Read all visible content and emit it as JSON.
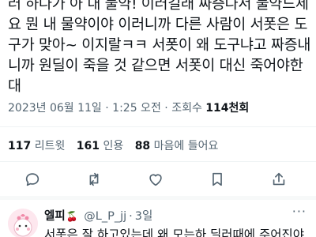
{
  "tweet": {
    "lines": [
      "러 하나가 아 내 물약! 이러길래 짜증나서 물약드세",
      "요 뭔 내 물약이야 이러니까 다른 사람이 서폿은 도",
      "구가 맞아~ 이지랄ㅋㅋ 서폿이 왜 도구냐고 짜증내",
      "니까 원딜이 죽을 것 같으면 서폿이 대신 죽어야한",
      "대"
    ],
    "date": "2023년 06월 11일",
    "time": "1:25 오전",
    "views_label": "조회수",
    "views_count": "114천회"
  },
  "stats": {
    "retweets_count": "117",
    "retweets_label": "리트윗",
    "quotes_count": "161",
    "quotes_label": "인용",
    "likes_count": "88",
    "likes_label": "마음에 들어요"
  },
  "actions": [
    "reply-icon",
    "retweet-icon",
    "like-icon",
    "bookmark-icon",
    "share-icon"
  ],
  "reply": {
    "name": "엘피",
    "emoji": "🍒",
    "handle": "@L_P_jj",
    "separator": "·",
    "time": "3일",
    "more": "···",
    "text": "서폿은 잘 하고있는데 왜 모는하 딜러때에 주어진야"
  },
  "colors": {
    "text": "#0f1419",
    "secondary": "#536471",
    "divider": "#eff3f4"
  }
}
